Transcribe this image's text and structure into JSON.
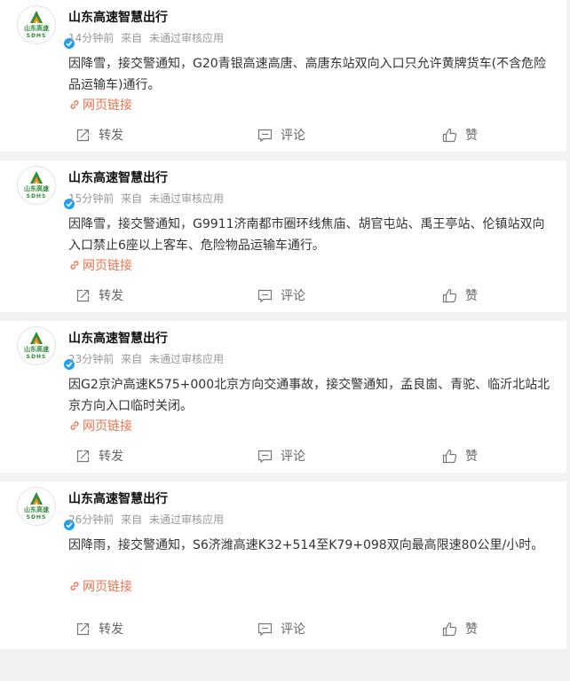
{
  "colors": {
    "accent_link": "#eb7350",
    "verified": "#1da0f2",
    "logo_green": "#2e8b35",
    "logo_orange": "#f08a24"
  },
  "posts": [
    {
      "account": "山东高速智慧出行",
      "time": "14分钟前",
      "from_label": "来自",
      "source": "未通过审核应用",
      "text": "因降雪，接交警通知，G20青银高速高唐、高唐东站双向入口只允许黄牌货车(不含危险品运输车)通行。",
      "link_label": "网页链接",
      "repost_label": "转发",
      "comment_label": "评论",
      "like_label": "赞"
    },
    {
      "account": "山东高速智慧出行",
      "time": "15分钟前",
      "from_label": "来自",
      "source": "未通过审核应用",
      "text": "因降雪，接交警通知，G9911济南都市圈环线焦庙、胡官屯站、禹王亭站、伦镇站双向入口禁止6座以上客车、危险物品运输车通行。",
      "link_label": "网页链接",
      "repost_label": "转发",
      "comment_label": "评论",
      "like_label": "赞"
    },
    {
      "account": "山东高速智慧出行",
      "time": "23分钟前",
      "from_label": "来自",
      "source": "未通过审核应用",
      "text": "因G2京沪高速K575+000北京方向交通事故，接交警通知，孟良崮、青驼、临沂北站北京方向入口临时关闭。",
      "link_label": "网页链接",
      "repost_label": "转发",
      "comment_label": "评论",
      "like_label": "赞"
    },
    {
      "account": "山东高速智慧出行",
      "time": "26分钟前",
      "from_label": "来自",
      "source": "未通过审核应用",
      "text": "因降雨，接交警通知，S6济潍高速K32+514至K79+098双向最高限速80公里/小时。",
      "link_label": "网页链接",
      "repost_label": "转发",
      "comment_label": "评论",
      "like_label": "赞"
    }
  ],
  "logo": {
    "text_cn": "山东高速",
    "text_en": "SDHS"
  }
}
